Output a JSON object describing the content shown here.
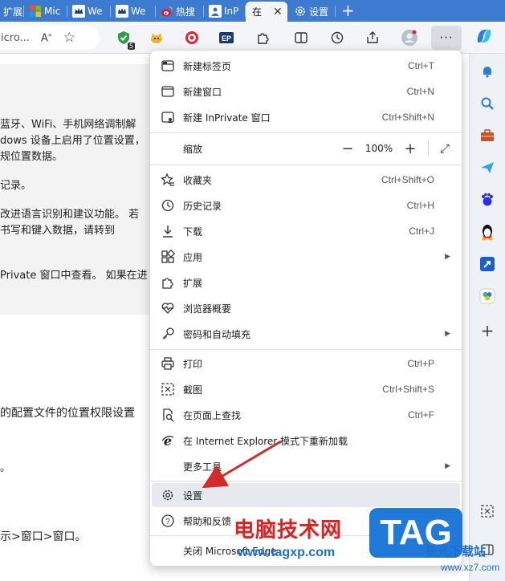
{
  "tabs": [
    {
      "label": "扩展",
      "icon": "document-icon"
    },
    {
      "label": "Mic",
      "icon": "microsoft-logo-icon"
    },
    {
      "label": "We",
      "icon": "crown-icon"
    },
    {
      "label": "We",
      "icon": "crown-icon"
    },
    {
      "label": "热搜",
      "icon": "weibo-icon"
    },
    {
      "label": "InP",
      "icon": "inprivate-icon"
    },
    {
      "label": "在",
      "icon": "none",
      "active": true
    },
    {
      "label": "设置",
      "icon": "gear-icon"
    }
  ],
  "address": {
    "text": "icro..."
  },
  "page": {
    "lines": [
      "蓝牙、WiFi、手机网络调制解",
      "dows 设备上启用了位置设置，",
      "规位置数据。",
      "记录。",
      "改进语言识别和建议功能。 若",
      "书写和键入数据，请转到",
      "Private 窗口中查看。 如果在进",
      "的配置文件的位置权限设置",
      "。",
      "示>窗口>窗口。"
    ]
  },
  "menu": {
    "items": [
      {
        "id": "new-tab",
        "label": "新建标签页",
        "shortcut": "Ctrl+T",
        "icon": "new-tab-icon"
      },
      {
        "id": "new-window",
        "label": "新建窗口",
        "shortcut": "Ctrl+N",
        "icon": "new-window-icon"
      },
      {
        "id": "new-inprivate",
        "label": "新建 InPrivate 窗口",
        "shortcut": "Ctrl+Shift+N",
        "icon": "inprivate-window-icon"
      },
      {
        "id": "zoom",
        "label": "缩放",
        "zoom": "100%"
      },
      {
        "id": "favorites",
        "label": "收藏夹",
        "shortcut": "Ctrl+Shift+O",
        "icon": "favorites-icon"
      },
      {
        "id": "history",
        "label": "历史记录",
        "shortcut": "Ctrl+H",
        "icon": "history-icon"
      },
      {
        "id": "downloads",
        "label": "下载",
        "shortcut": "Ctrl+J",
        "icon": "download-icon"
      },
      {
        "id": "apps",
        "label": "应用",
        "icon": "apps-icon"
      },
      {
        "id": "extensions",
        "label": "扩展",
        "icon": "extensions-icon"
      },
      {
        "id": "browser-essentials",
        "label": "浏览器概要",
        "icon": "heart-pulse-icon"
      },
      {
        "id": "passwords",
        "label": "密码和自动填充",
        "icon": "key-icon"
      },
      {
        "id": "print",
        "label": "打印",
        "shortcut": "Ctrl+P",
        "icon": "print-icon"
      },
      {
        "id": "screenshot",
        "label": "截图",
        "shortcut": "Ctrl+Shift+S",
        "icon": "screenshot-icon"
      },
      {
        "id": "find",
        "label": "在页面上查找",
        "shortcut": "Ctrl+F",
        "icon": "find-icon"
      },
      {
        "id": "ie-mode",
        "label": "在 Internet Explorer 模式下重新加载",
        "icon": "internet-explorer-icon"
      },
      {
        "id": "more-tools",
        "label": "更多工具"
      },
      {
        "id": "settings",
        "label": "设置",
        "icon": "gear-icon"
      },
      {
        "id": "help",
        "label": "帮助和反馈",
        "icon": "help-icon"
      },
      {
        "id": "close",
        "label": "关闭 Microsoft Edge"
      }
    ]
  },
  "watermark": {
    "line1": "电脑技术网",
    "line2": "www.tagxp.com",
    "tag": "TAG",
    "line3": "极光下载站",
    "line4": "www.xz7.com"
  },
  "colors": {
    "tabstrip": "#3d7bd1",
    "arrow": "#d42a2a",
    "highlight": "#e6e9ee"
  }
}
